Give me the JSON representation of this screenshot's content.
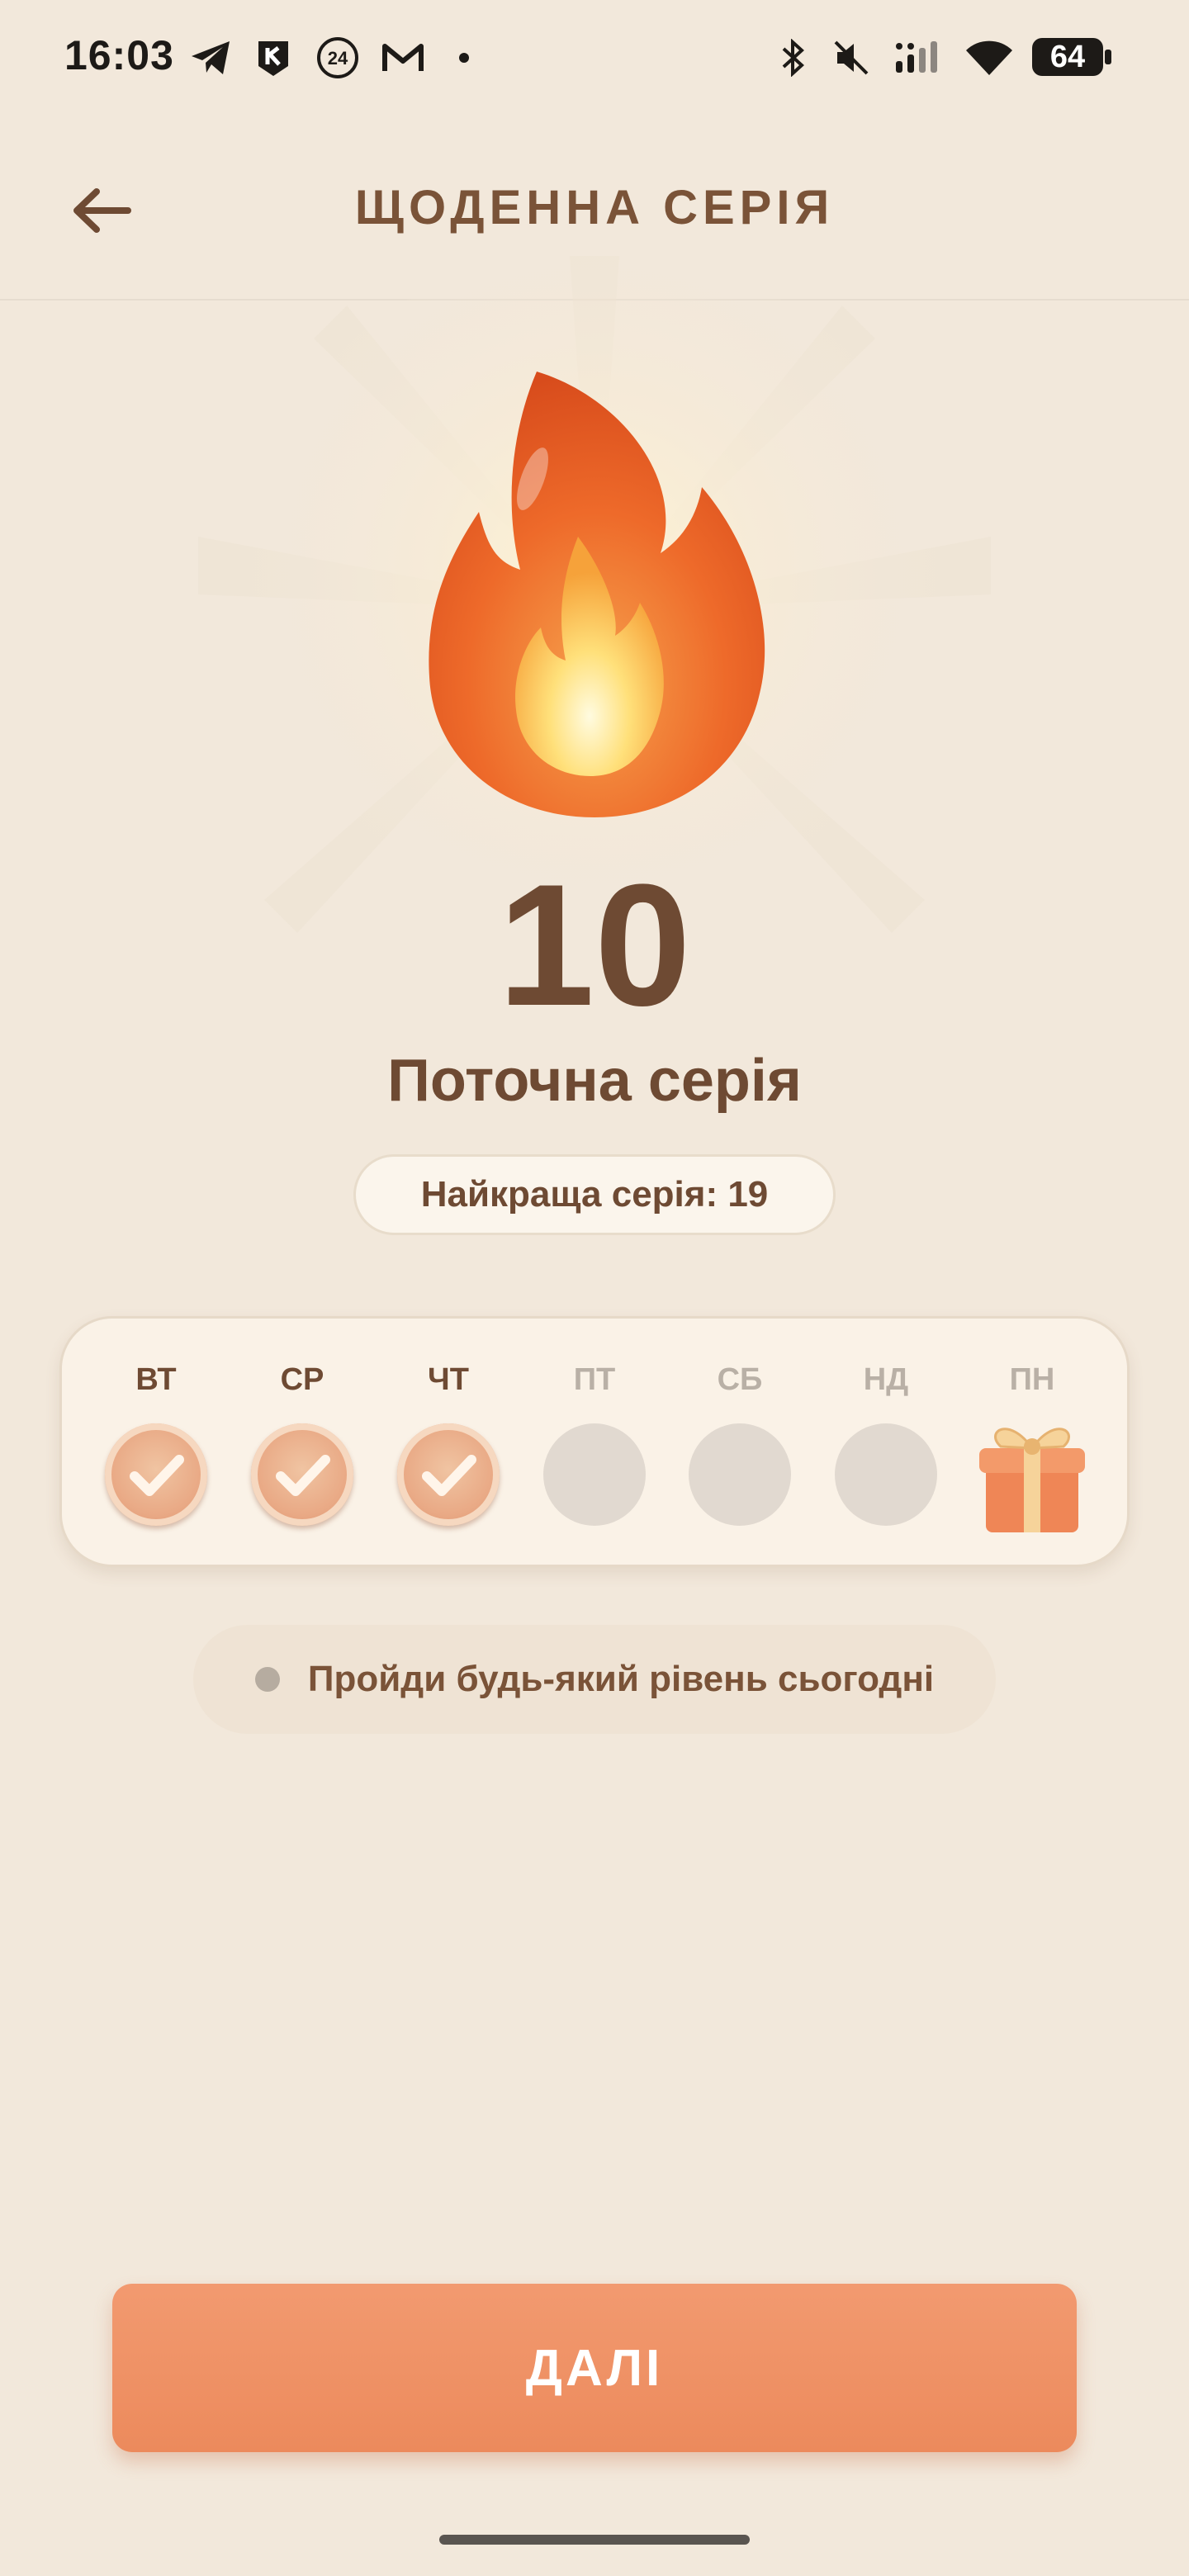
{
  "status_bar": {
    "time": "16:03",
    "battery": "64",
    "icons": [
      "telegram-icon",
      "k-app-icon",
      "badge-24-icon",
      "gmail-icon",
      "dot-icon",
      "bluetooth-icon",
      "mute-icon",
      "signal-icon",
      "wifi-icon"
    ]
  },
  "header": {
    "title": "ЩОДЕННА СЕРІЯ",
    "back_icon": "arrow-left-icon"
  },
  "streak": {
    "current": "10",
    "label": "Поточна серія",
    "best": "Найкраща серія: 19"
  },
  "week": {
    "days": [
      {
        "label": "ВТ",
        "done": true
      },
      {
        "label": "СР",
        "done": true
      },
      {
        "label": "ЧТ",
        "done": true
      },
      {
        "label": "ПТ",
        "done": false
      },
      {
        "label": "СБ",
        "done": false
      },
      {
        "label": "НД",
        "done": false
      },
      {
        "label": "ПН",
        "reward": "gift-icon"
      }
    ]
  },
  "hint": {
    "text": "Пройди будь-який рівень сьогодні"
  },
  "footer": {
    "next_label": "ДАЛІ"
  },
  "colors": {
    "background": "#f2e8db",
    "accent": "#ec8a5c",
    "text": "#6e4a33"
  }
}
